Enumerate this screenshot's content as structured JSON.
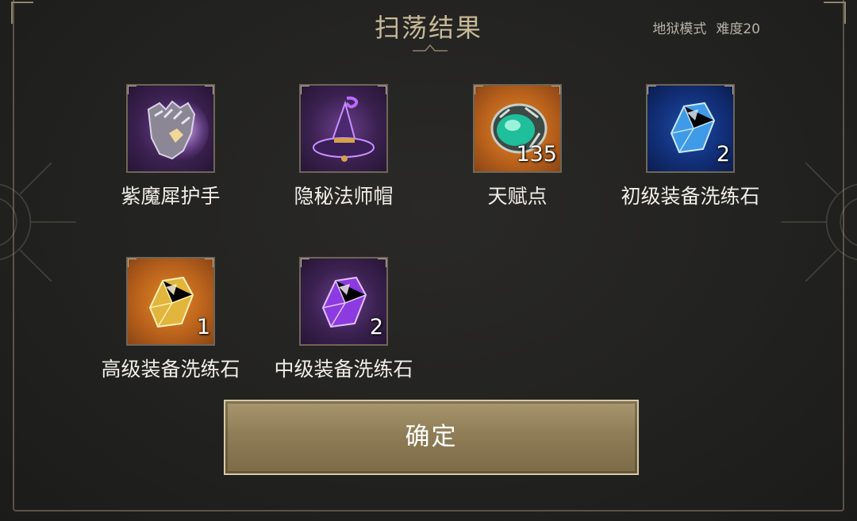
{
  "dialog": {
    "title": "扫荡结果",
    "mode_label": "地狱模式",
    "difficulty_label": "难度20"
  },
  "rewards": [
    {
      "name": "紫魔犀护手",
      "count": "",
      "icon": "purple-gauntlet-icon",
      "bg_color": "#3b2150"
    },
    {
      "name": "隐秘法师帽",
      "count": "",
      "icon": "wizard-hat-icon",
      "bg_color": "#3b2150"
    },
    {
      "name": "天赋点",
      "count": "135",
      "icon": "green-gem-ring-icon",
      "bg_color": "#b7601c"
    },
    {
      "name": "初级装备洗练石",
      "count": "2",
      "icon": "blue-crystal-icon",
      "bg_color": "#12307a"
    },
    {
      "name": "高级装备洗练石",
      "count": "1",
      "icon": "gold-crystal-icon",
      "bg_color": "#b7601c"
    },
    {
      "name": "中级装备洗练石",
      "count": "2",
      "icon": "purple-crystal-icon",
      "bg_color": "#3b2150"
    }
  ],
  "confirm_button": {
    "label": "确定"
  },
  "colors": {
    "title": "#c9b998",
    "button_gold": "#8f7d57",
    "panel_bg": "#222220"
  }
}
